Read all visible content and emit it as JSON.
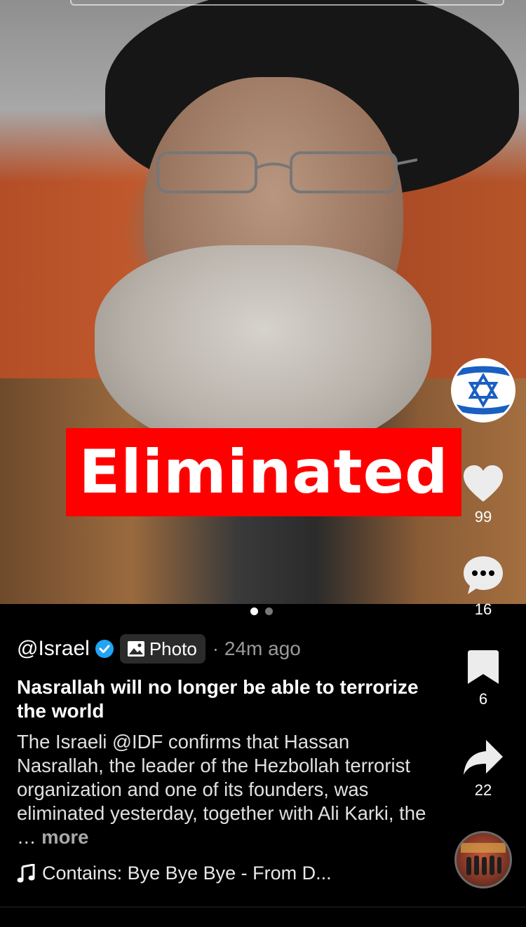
{
  "post": {
    "banner_text": "Eliminated",
    "handle": "@Israel",
    "media_type_label": "Photo",
    "time_ago": "· 24m ago",
    "title": "Nasrallah will no longer be able to terrorize the world",
    "description": "The Israeli @IDF confirms that Hassan Nasrallah, the leader of the Hezbollah terrorist organization and one of its founders, was eliminated yesterday, together with Ali Karki, the …",
    "more_label": "more",
    "music_label": "Contains: Bye Bye Bye - From D...",
    "carousel": {
      "total": 2,
      "active_index": 0
    }
  },
  "actions": {
    "likes": "99",
    "comments": "16",
    "bookmarks": "6",
    "shares": "22"
  },
  "colors": {
    "banner_red": "#ff0000",
    "verified_blue": "#20a4f3",
    "flag_blue": "#1a5fc2"
  },
  "icons": {
    "like": "heart-icon",
    "comment": "comment-bubble-icon",
    "bookmark": "bookmark-icon",
    "share": "share-arrow-icon",
    "music": "music-note-icon",
    "verified": "verified-check-icon",
    "photo": "photo-icon"
  }
}
